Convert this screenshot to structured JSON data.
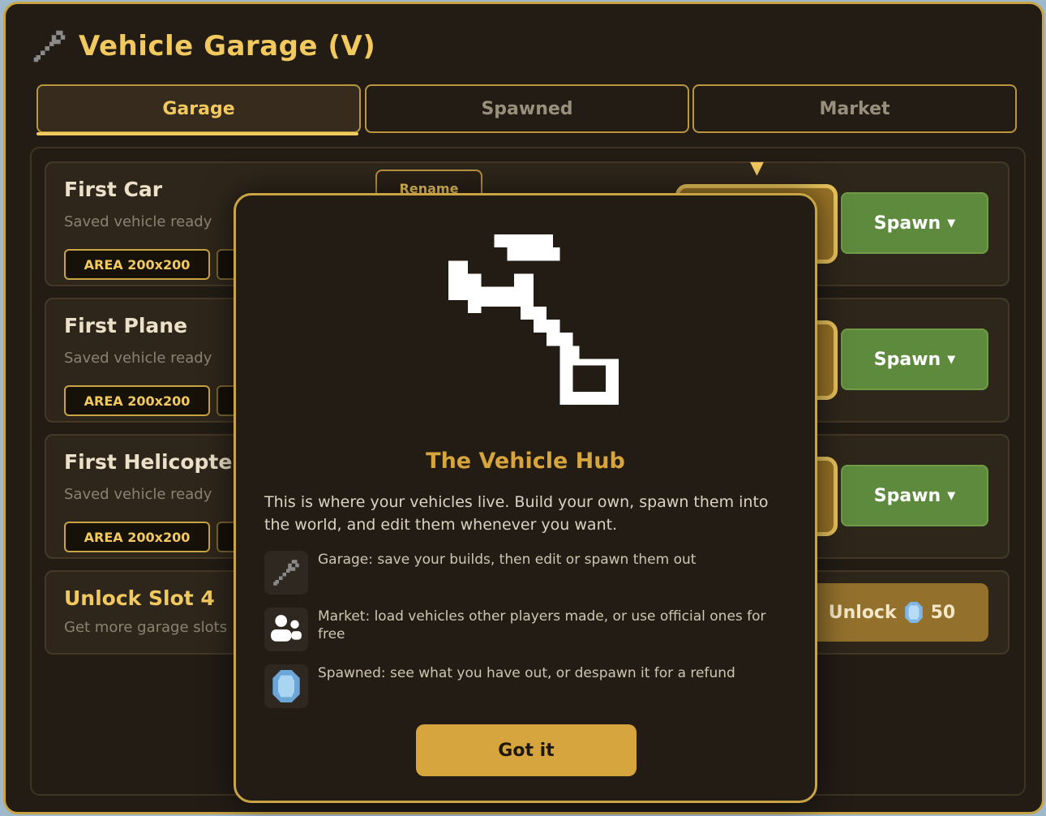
{
  "window": {
    "title": "Vehicle Garage (V)",
    "title_icon": "wrench-icon"
  },
  "tabs": [
    {
      "label": "Garage",
      "active": true
    },
    {
      "label": "Spawned",
      "active": false
    },
    {
      "label": "Market",
      "active": false
    }
  ],
  "vehicles": [
    {
      "name": "First Car",
      "status": "Saved vehicle ready",
      "tag": "AREA 200x200",
      "rename_label": "Rename",
      "spawn_label": "Spawn"
    },
    {
      "name": "First Plane",
      "status": "Saved vehicle ready",
      "tag": "AREA 200x200",
      "spawn_label": "Spawn"
    },
    {
      "name": "First Helicopter",
      "status": "Saved vehicle ready",
      "tag": "AREA 200x200",
      "spawn_label": "Spawn"
    }
  ],
  "unlock_slot": {
    "title": "Unlock Slot 4",
    "subtitle": "Get more garage slots",
    "button_label": "Unlock",
    "cost": "50",
    "cost_icon": "gem-icon"
  },
  "colors": {
    "accent": "#f2c95e",
    "panel_bg": "#221c15",
    "spawn_green": "#5e8a3e",
    "modal_title": "#d6a53d"
  },
  "modal": {
    "title": "The Vehicle Hub",
    "description": "This is where your vehicles live. Build your own, spawn them into the world, and edit them whenever you want.",
    "items": [
      {
        "icon": "wrench-icon",
        "text": "Garage: save your builds, then edit or spawn them out"
      },
      {
        "icon": "players-icon",
        "text": "Market: load vehicles other players made, or use official ones for free"
      },
      {
        "icon": "gem-icon",
        "text": "Spawned: see what you have out, or despawn it for a refund"
      }
    ],
    "confirm_label": "Got it"
  }
}
